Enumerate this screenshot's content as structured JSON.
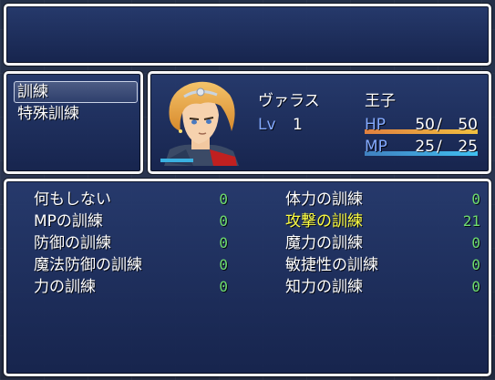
{
  "help": {
    "text": ""
  },
  "command_menu": {
    "items": [
      {
        "label": "訓練",
        "selected": true
      },
      {
        "label": "特殊訓練",
        "selected": false
      }
    ]
  },
  "actor": {
    "name": "ヴァラス",
    "class": "王子",
    "level_label": "Lv",
    "level": "1",
    "hp_label": "HP",
    "hp": "50",
    "mhp": "50",
    "mp_label": "MP",
    "mp": "25",
    "mmp": "25",
    "hp_ratio": 1.0,
    "mp_ratio": 1.0,
    "colors": {
      "hp_from": "#e08040",
      "hp_to": "#f0c040",
      "mp_from": "#4080c0",
      "mp_to": "#40c0f0"
    }
  },
  "training": {
    "left": [
      {
        "label": "何もしない",
        "value": "0"
      },
      {
        "label": "MPの訓練",
        "value": "0"
      },
      {
        "label": "防御の訓練",
        "value": "0"
      },
      {
        "label": "魔法防御の訓練",
        "value": "0"
      },
      {
        "label": "力の訓練",
        "value": "0"
      }
    ],
    "right": [
      {
        "label": "体力の訓練",
        "value": "0"
      },
      {
        "label": "攻撃の訓練",
        "value": "21",
        "highlight": true
      },
      {
        "label": "魔力の訓練",
        "value": "0"
      },
      {
        "label": "敏捷性の訓練",
        "value": "0"
      },
      {
        "label": "知力の訓練",
        "value": "0"
      }
    ]
  }
}
